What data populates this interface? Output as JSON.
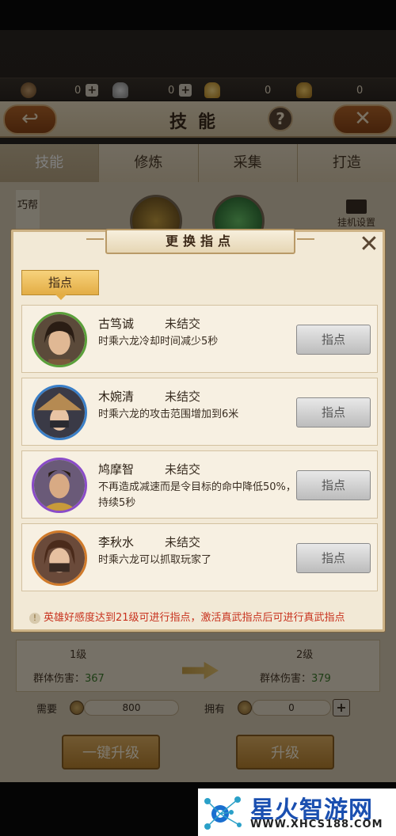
{
  "currency": [
    {
      "name": "copper",
      "value": "0",
      "has_plus": true
    },
    {
      "name": "silver",
      "value": "0",
      "has_plus": true
    },
    {
      "name": "gold",
      "value": "0",
      "has_plus": false
    },
    {
      "name": "bound-gold",
      "value": "0",
      "has_plus": false
    }
  ],
  "header": {
    "title": "技能",
    "back_symbol": "↩",
    "help_symbol": "?",
    "close_symbol": "✕"
  },
  "tabs": [
    "技能",
    "修炼",
    "采集",
    "打造"
  ],
  "background": {
    "side_label": "巧帮",
    "hang_label": "挂机设置",
    "level_left": {
      "label": "1级",
      "stat_label": "群体伤害：",
      "stat_value": "367"
    },
    "level_right": {
      "label": "2级",
      "stat_label": "群体伤害：",
      "stat_value": "379"
    },
    "need_label": "需要",
    "need_value": "800",
    "own_label": "拥有",
    "own_value": "0",
    "btn_upgrade_all": "一键升级",
    "btn_upgrade": "升级"
  },
  "modal": {
    "title": "更换指点",
    "close_symbol": "✕",
    "sub_tab": "指点",
    "heroes": [
      {
        "name": "古笃诚",
        "status": "未结交",
        "desc": "时乘六龙冷却时间减少5秒",
        "btn": "指点",
        "ring": "#5aa03a"
      },
      {
        "name": "木婉清",
        "status": "未结交",
        "desc": "时乘六龙的攻击范围增加到6米",
        "btn": "指点",
        "ring": "#3a7fc8"
      },
      {
        "name": "鸠摩智",
        "status": "未结交",
        "desc": "不再造成减速而是令目标的命中降低50%，持续5秒",
        "btn": "指点",
        "ring": "#8a4cc8"
      },
      {
        "name": "李秋水",
        "status": "未结交",
        "desc": "时乘六龙可以抓取玩家了",
        "btn": "指点",
        "ring": "#d07a2a"
      }
    ],
    "tip": "英雄好感度达到21级可进行指点，激活真武指点后可进行真武指点"
  },
  "watermark": {
    "title": "星火智游网",
    "url": "WWW.XHCS188.COM"
  }
}
